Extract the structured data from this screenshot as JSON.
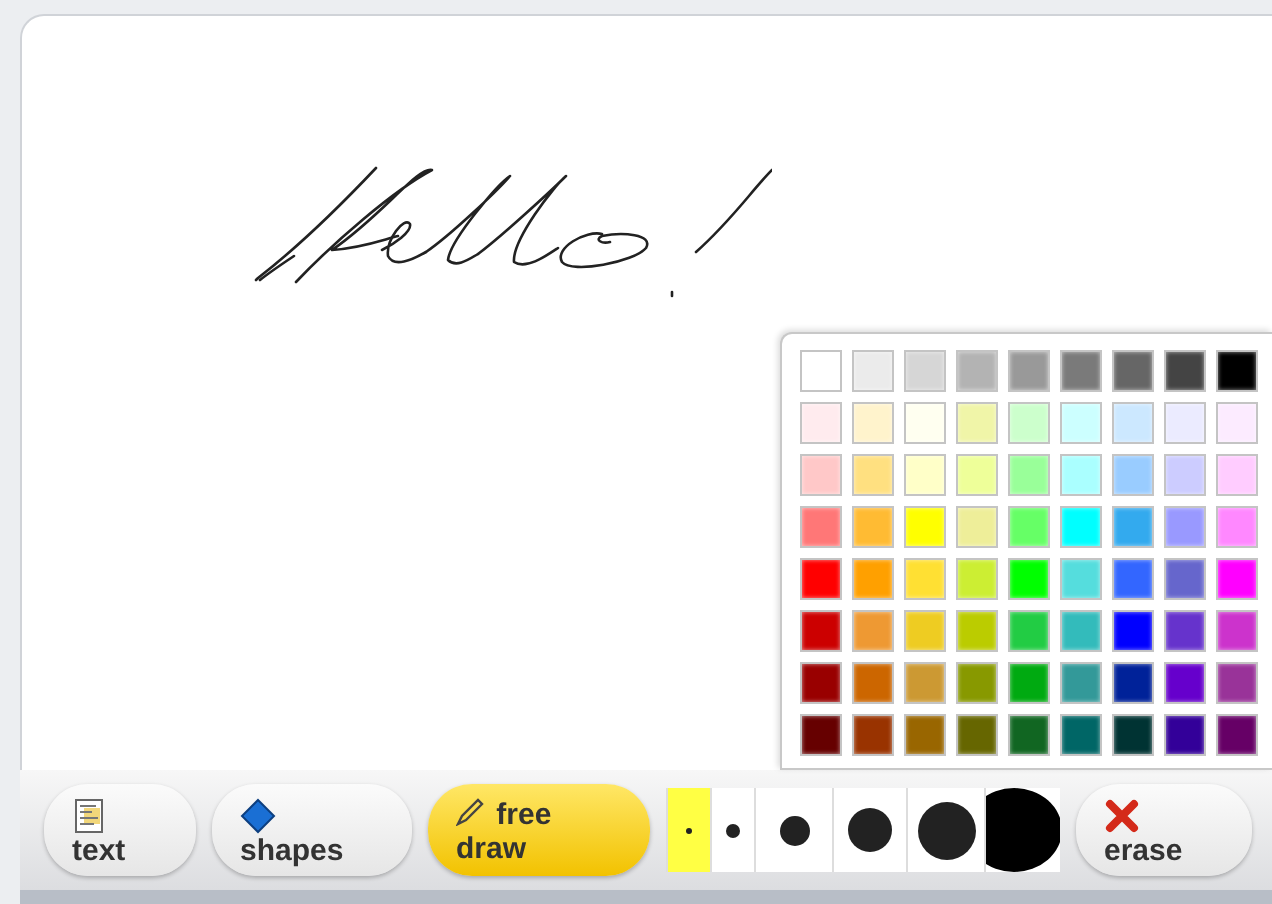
{
  "palette": {
    "colors": [
      {
        "color": "#ffffff"
      },
      {
        "color": "#ebebeb"
      },
      {
        "color": "#d6d6d6"
      },
      {
        "color": "#b3b3b3"
      },
      {
        "color": "#999999"
      },
      {
        "color": "#7a7a7a"
      },
      {
        "color": "#666666"
      },
      {
        "color": "#444444"
      },
      {
        "color": "#000000"
      },
      {
        "color": "#ffebee"
      },
      {
        "color": "#fff3cc"
      },
      {
        "color": "#fffff0"
      },
      {
        "color": "#f0f5a8"
      },
      {
        "color": "#ccffcc"
      },
      {
        "color": "#ccffff"
      },
      {
        "color": "#cce8ff"
      },
      {
        "color": "#ebebff"
      },
      {
        "color": "#fcebff"
      },
      {
        "color": "#ffc8c8"
      },
      {
        "color": "#ffe080"
      },
      {
        "color": "#ffffc8"
      },
      {
        "color": "#eeff99"
      },
      {
        "color": "#99ff99"
      },
      {
        "color": "#aaffff"
      },
      {
        "color": "#99ccff"
      },
      {
        "color": "#ccccff"
      },
      {
        "color": "#ffccff"
      },
      {
        "color": "#ff7777"
      },
      {
        "color": "#ffbb33"
      },
      {
        "color": "#ffff00"
      },
      {
        "color": "#eeee99"
      },
      {
        "color": "#66ff66"
      },
      {
        "color": "#00ffff"
      },
      {
        "color": "#33aaee"
      },
      {
        "color": "#9999ff"
      },
      {
        "color": "#ff88ff"
      },
      {
        "color": "#ff0000"
      },
      {
        "color": "#ffa000"
      },
      {
        "color": "#ffe033"
      },
      {
        "color": "#ccee33"
      },
      {
        "color": "#00ff00"
      },
      {
        "color": "#55dddd"
      },
      {
        "color": "#3366ff"
      },
      {
        "color": "#6666cc"
      },
      {
        "color": "#ff00ff"
      },
      {
        "color": "#cc0000"
      },
      {
        "color": "#ee9933"
      },
      {
        "color": "#eecc22"
      },
      {
        "color": "#bbcc00"
      },
      {
        "color": "#22cc44"
      },
      {
        "color": "#33bbbb"
      },
      {
        "color": "#0000ff"
      },
      {
        "color": "#6633cc"
      },
      {
        "color": "#cc33cc"
      },
      {
        "color": "#990000"
      },
      {
        "color": "#cc6600"
      },
      {
        "color": "#cc9933"
      },
      {
        "color": "#889900"
      },
      {
        "color": "#00aa11"
      },
      {
        "color": "#339999"
      },
      {
        "color": "#002299"
      },
      {
        "color": "#6600cc"
      },
      {
        "color": "#993399"
      },
      {
        "color": "#660000"
      },
      {
        "color": "#993300"
      },
      {
        "color": "#996600"
      },
      {
        "color": "#666600"
      },
      {
        "color": "#116622"
      },
      {
        "color": "#006666"
      },
      {
        "color": "#003333"
      },
      {
        "color": "#330099"
      },
      {
        "color": "#660066"
      }
    ]
  },
  "tools": [
    {
      "kind": "text",
      "label": "text",
      "selected": false
    },
    {
      "kind": "shapes",
      "label": "shapes",
      "selected": false
    },
    {
      "kind": "freedraw",
      "label": "free draw",
      "selected": true
    }
  ],
  "brush_sizes": [
    {
      "selected": true
    },
    {
      "selected": false
    },
    {
      "selected": false
    },
    {
      "selected": false
    },
    {
      "selected": false
    },
    {
      "selected": false
    }
  ],
  "erase_button": {
    "label": "erase"
  }
}
